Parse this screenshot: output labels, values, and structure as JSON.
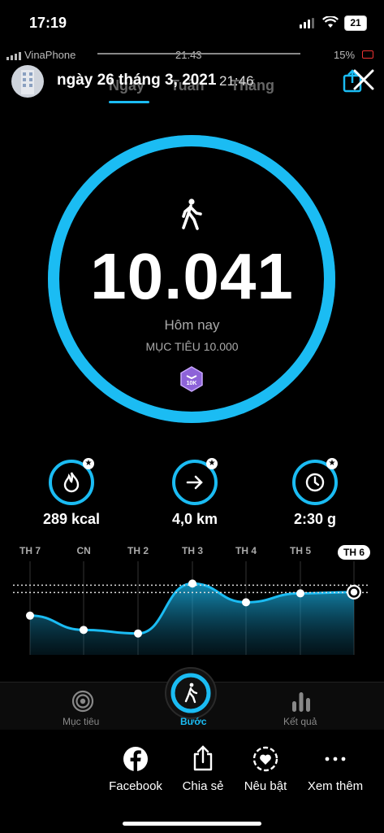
{
  "ios_status": {
    "time": "17:19",
    "battery": "21"
  },
  "inner_status": {
    "carrier": "VinaPhone",
    "time": "21:43",
    "battery": "15%"
  },
  "overlay": {
    "title": "ngày 26 tháng 3, 2021",
    "time": "21:46"
  },
  "tabs": [
    {
      "label": "Ngày"
    },
    {
      "label": "Tuần"
    },
    {
      "label": "Tháng"
    }
  ],
  "today": {
    "steps": "10.041",
    "label": "Hôm nay",
    "goal": "MỤC TIÊU 10.000",
    "badge": "10K",
    "progress": 1.0
  },
  "stats": [
    {
      "value": "289 kcal",
      "icon": "flame-icon"
    },
    {
      "value": "4,0 km",
      "icon": "arrow-right-icon"
    },
    {
      "value": "2:30 g",
      "icon": "clock-icon"
    }
  ],
  "chart_data": {
    "type": "area",
    "categories": [
      "TH 7",
      "CN",
      "TH 2",
      "TH 3",
      "TH 4",
      "TH 5",
      "TH 6"
    ],
    "values": [
      7400,
      5800,
      5400,
      11000,
      8900,
      9900,
      10041
    ],
    "goal": 10000,
    "active_index": 6,
    "ylim": [
      3000,
      13500
    ],
    "accent": "#1bbcf3"
  },
  "bottom_nav": [
    {
      "label": "Mục tiêu",
      "icon": "target-icon"
    },
    {
      "label": "Bước",
      "icon": "walk-icon"
    },
    {
      "label": "Kết quả",
      "icon": "bar-chart-icon"
    }
  ],
  "share_sheet": [
    {
      "label": "Facebook",
      "icon": "facebook-icon"
    },
    {
      "label": "Chia sẻ",
      "icon": "share-icon"
    },
    {
      "label": "Nêu bật",
      "icon": "heart-circle-icon"
    },
    {
      "label": "Xem thêm",
      "icon": "more-icon"
    }
  ],
  "colors": {
    "accent": "#1bbcf3",
    "background": "#000000"
  }
}
